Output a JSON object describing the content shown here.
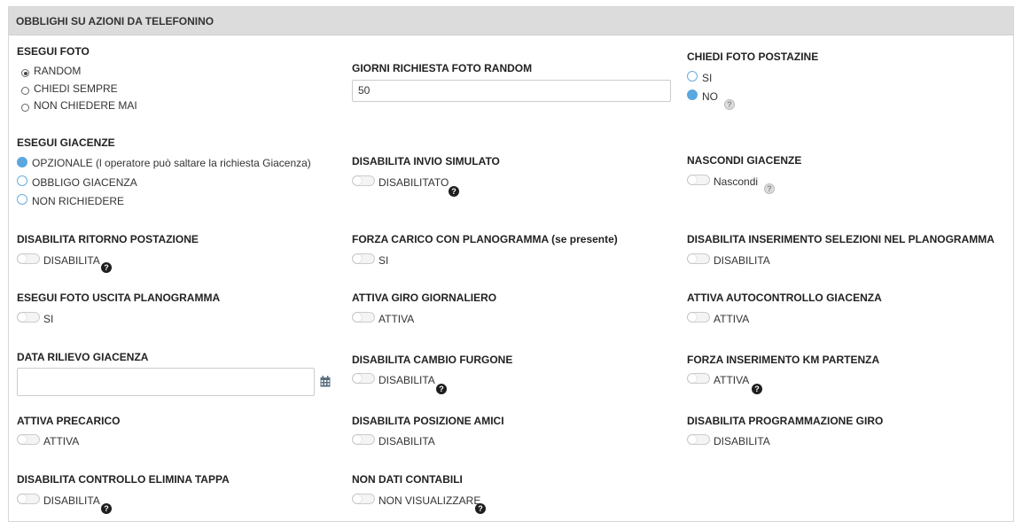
{
  "section": {
    "title": "OBBLIGHI SU AZIONI DA TELEFONINO"
  },
  "esegui_foto": {
    "label": "ESEGUI FOTO",
    "options": [
      "RANDOM",
      "CHIEDI SEMPRE",
      "NON CHIEDERE MAI"
    ],
    "selected": "RANDOM"
  },
  "giorni_richiesta": {
    "label": "GIORNI RICHIESTA FOTO RANDOM",
    "value": "50"
  },
  "chiedi_foto_postazione": {
    "label": "CHIEDI FOTO POSTAZINE",
    "options": [
      "SI",
      "NO"
    ],
    "selected": "NO"
  },
  "esegui_giacenze": {
    "label": "ESEGUI GIACENZE",
    "options": [
      "OPZIONALE (l operatore può saltare la richiesta Giacenza)",
      "OBBLIGO GIACENZA",
      "NON RICHIEDERE"
    ],
    "selected": "OPZIONALE (l operatore può saltare la richiesta Giacenza)"
  },
  "disabilita_invio_simulato": {
    "label": "DISABILITA INVIO SIMULATO",
    "toggle_label": "DISABILITATO"
  },
  "nascondi_giacenze": {
    "label": "NASCONDI GIACENZE",
    "toggle_label": "Nascondi"
  },
  "disabilita_ritorno_postazione": {
    "label": "DISABILITA RITORNO POSTAZIONE",
    "toggle_label": "DISABILITA"
  },
  "forza_carico_planogramma": {
    "label": "FORZA CARICO CON PLANOGRAMMA (se presente)",
    "toggle_label": "SI"
  },
  "disabilita_inserimento_selezioni": {
    "label": "DISABILITA INSERIMENTO SELEZIONI NEL PLANOGRAMMA",
    "toggle_label": "DISABILITA"
  },
  "esegui_foto_uscita": {
    "label": "ESEGUI FOTO USCITA PLANOGRAMMA",
    "toggle_label": "SI"
  },
  "attiva_giro_giornaliero": {
    "label": "ATTIVA GIRO GIORNALIERO",
    "toggle_label": "ATTIVA"
  },
  "attiva_autocontrollo": {
    "label": "ATTIVA AUTOCONTROLLO GIACENZA",
    "toggle_label": "ATTIVA"
  },
  "data_rilievo": {
    "label": "DATA RILIEVO GIACENZA",
    "value": ""
  },
  "disabilita_cambio_furgone": {
    "label": "DISABILITA CAMBIO FURGONE",
    "toggle_label": "DISABILITA"
  },
  "forza_km_partenza": {
    "label": "FORZA INSERIMENTO KM PARTENZA",
    "toggle_label": "ATTIVA"
  },
  "attiva_precarico": {
    "label": "ATTIVA PRECARICO",
    "toggle_label": "ATTIVA"
  },
  "disabilita_posizione_amici": {
    "label": "DISABILITA POSIZIONE AMICI",
    "toggle_label": "DISABILITA"
  },
  "disabilita_programmazione_giro": {
    "label": "DISABILITA PROGRAMMAZIONE GIRO",
    "toggle_label": "DISABILITA"
  },
  "disabilita_controllo_elimina": {
    "label": "DISABILITA CONTROLLO ELIMINA TAPPA",
    "toggle_label": "DISABILITA"
  },
  "non_dati_contabili": {
    "label": "NON DATI CONTABILI",
    "toggle_label": "NON VISUALIZZARE"
  },
  "help": {
    "symbol": "?"
  },
  "colors": {
    "accent": "#5ba7e0",
    "header_bg": "#dcdcdc"
  }
}
